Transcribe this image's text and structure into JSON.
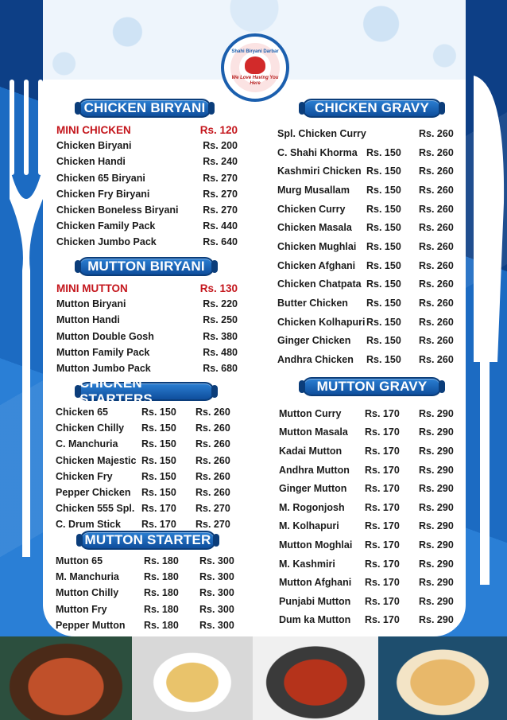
{
  "logo": {
    "brand": "Shahi Biryani Darbar",
    "tagline": "We Love Having You Here"
  },
  "colors": {
    "header_blue": "#1b5fae",
    "mini_red": "#c4161c"
  },
  "chicken_biryani": {
    "title": "CHICKEN BIRYANI",
    "items": [
      {
        "name": "MINI CHICKEN",
        "price": "Rs. 120"
      },
      {
        "name": "Chicken Biryani",
        "price": "Rs. 200"
      },
      {
        "name": "Chicken Handi",
        "price": "Rs. 240"
      },
      {
        "name": "Chicken 65 Biryani",
        "price": "Rs. 270"
      },
      {
        "name": "Chicken Fry Biryani",
        "price": "Rs. 270"
      },
      {
        "name": "Chicken Boneless Biryani",
        "price": "Rs. 270"
      },
      {
        "name": "Chicken Family Pack",
        "price": "Rs. 440"
      },
      {
        "name": "Chicken Jumbo Pack",
        "price": "Rs. 640"
      }
    ]
  },
  "mutton_biryani": {
    "title": "MUTTON BIRYANI",
    "items": [
      {
        "name": "MINI MUTTON",
        "price": "Rs. 130"
      },
      {
        "name": "Mutton Biryani",
        "price": "Rs. 220"
      },
      {
        "name": "Mutton Handi",
        "price": "Rs. 250"
      },
      {
        "name": "Mutton Double Gosh",
        "price": "Rs. 380"
      },
      {
        "name": "Mutton Family Pack",
        "price": "Rs. 480"
      },
      {
        "name": "Mutton Jumbo Pack",
        "price": "Rs. 680"
      }
    ]
  },
  "chicken_starters": {
    "title": "CHICKEN  STARTERS",
    "items": [
      {
        "name": "Chicken 65",
        "p1": "Rs. 150",
        "p2": "Rs. 260"
      },
      {
        "name": "Chicken Chilly",
        "p1": "Rs. 150",
        "p2": "Rs. 260"
      },
      {
        "name": "C. Manchuria",
        "p1": "Rs. 150",
        "p2": "Rs. 260"
      },
      {
        "name": "Chicken Majestic",
        "p1": "Rs. 150",
        "p2": "Rs. 260"
      },
      {
        "name": "Chicken Fry",
        "p1": "Rs. 150",
        "p2": "Rs. 260"
      },
      {
        "name": "Pepper Chicken",
        "p1": "Rs. 150",
        "p2": "Rs. 260"
      },
      {
        "name": "Chicken 555 Spl.",
        "p1": "Rs. 170",
        "p2": "Rs. 270"
      },
      {
        "name": "C. Drum Stick",
        "p1": "Rs. 170",
        "p2": "Rs. 270"
      }
    ]
  },
  "mutton_starter": {
    "title": "MUTTON STARTER",
    "items": [
      {
        "name": "Mutton 65",
        "p1": "Rs. 180",
        "p2": "Rs. 300"
      },
      {
        "name": "M. Manchuria",
        "p1": "Rs. 180",
        "p2": "Rs. 300"
      },
      {
        "name": "Mutton Chilly",
        "p1": "Rs. 180",
        "p2": "Rs. 300"
      },
      {
        "name": "Mutton Fry",
        "p1": "Rs. 180",
        "p2": "Rs. 300"
      },
      {
        "name": "Pepper Mutton",
        "p1": "Rs. 180",
        "p2": "Rs. 300"
      }
    ]
  },
  "chicken_gravy": {
    "title": "CHICKEN GRAVY",
    "items": [
      {
        "name": "Spl. Chicken Curry",
        "p1": "",
        "p2": "Rs. 260"
      },
      {
        "name": "C. Shahi Khorma",
        "p1": "Rs. 150",
        "p2": "Rs. 260"
      },
      {
        "name": "Kashmiri Chicken",
        "p1": "Rs. 150",
        "p2": "Rs. 260"
      },
      {
        "name": "Murg Musallam",
        "p1": "Rs. 150",
        "p2": "Rs. 260"
      },
      {
        "name": "Chicken Curry",
        "p1": "Rs. 150",
        "p2": "Rs. 260"
      },
      {
        "name": "Chicken Masala",
        "p1": "Rs. 150",
        "p2": "Rs. 260"
      },
      {
        "name": "Chicken Mughlai",
        "p1": "Rs. 150",
        "p2": "Rs. 260"
      },
      {
        "name": "Chicken Afghani",
        "p1": "Rs. 150",
        "p2": "Rs. 260"
      },
      {
        "name": "Chicken Chatpata",
        "p1": "Rs. 150",
        "p2": "Rs. 260"
      },
      {
        "name": "Butter Chicken",
        "p1": "Rs. 150",
        "p2": "Rs. 260"
      },
      {
        "name": "Chicken Kolhapuri",
        "p1": "Rs. 150",
        "p2": "Rs. 260"
      },
      {
        "name": "Ginger Chicken",
        "p1": "Rs. 150",
        "p2": "Rs. 260"
      },
      {
        "name": "Andhra Chicken",
        "p1": "Rs. 150",
        "p2": "Rs. 260"
      }
    ]
  },
  "mutton_gravy": {
    "title": "MUTTON GRAVY",
    "items": [
      {
        "name": "Mutton Curry",
        "p1": "Rs. 170",
        "p2": "Rs. 290"
      },
      {
        "name": "Mutton Masala",
        "p1": "Rs. 170",
        "p2": "Rs. 290"
      },
      {
        "name": "Kadai Mutton",
        "p1": "Rs. 170",
        "p2": "Rs. 290"
      },
      {
        "name": "Andhra Mutton",
        "p1": "Rs. 170",
        "p2": "Rs. 290"
      },
      {
        "name": "Ginger Mutton",
        "p1": "Rs. 170",
        "p2": "Rs. 290"
      },
      {
        "name": "M. Rogonjosh",
        "p1": "Rs. 170",
        "p2": "Rs. 290"
      },
      {
        "name": "M. Kolhapuri",
        "p1": "Rs. 170",
        "p2": "Rs. 290"
      },
      {
        "name": "Mutton Moghlai",
        "p1": "Rs. 170",
        "p2": "Rs. 290"
      },
      {
        "name": "M. Kashmiri",
        "p1": "Rs. 170",
        "p2": "Rs. 290"
      },
      {
        "name": "Mutton Afghani",
        "p1": "Rs. 170",
        "p2": "Rs. 290"
      },
      {
        "name": "Punjabi Mutton",
        "p1": "Rs. 170",
        "p2": "Rs. 290"
      },
      {
        "name": "Dum ka Mutton",
        "p1": "Rs. 170",
        "p2": "Rs. 290"
      }
    ]
  }
}
